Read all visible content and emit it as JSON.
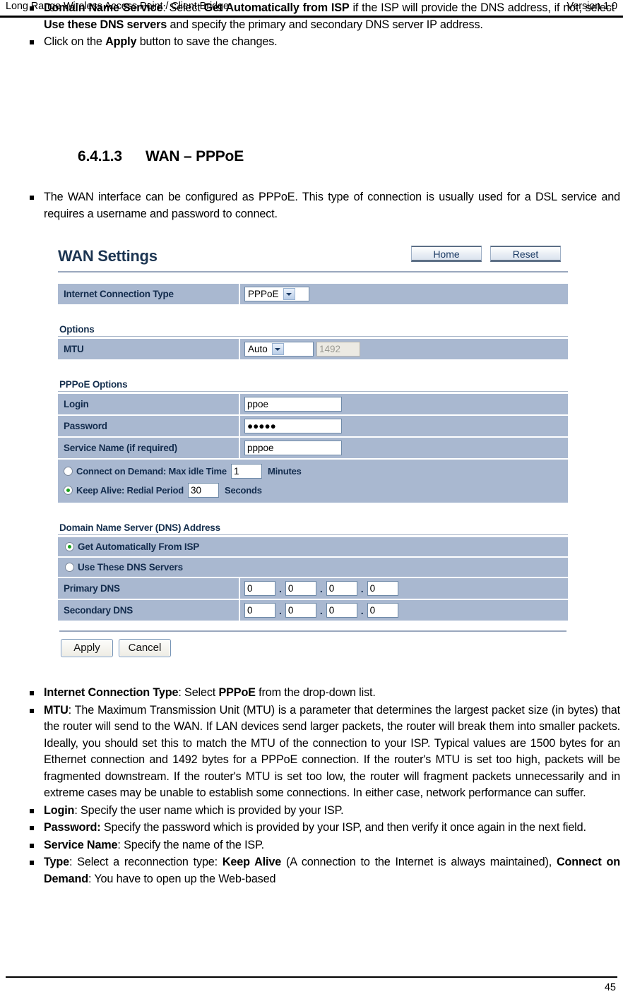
{
  "header": {
    "left": "Long Range Wireless Access Point / Client Bridge",
    "right": "Version 1.0"
  },
  "top_bullets": [
    {
      "parts": [
        {
          "t": "Domain Name Service",
          "b": true
        },
        {
          "t": ": Select ",
          "b": false
        },
        {
          "t": "Get Automatically from ISP",
          "b": true
        },
        {
          "t": " if the ISP will provide the DNS address, if not, select ",
          "b": false
        },
        {
          "t": "Use these DNS servers",
          "b": true
        },
        {
          "t": " and specify the primary and secondary DNS server IP address.",
          "b": false
        }
      ]
    },
    {
      "parts": [
        {
          "t": "Click on the ",
          "b": false
        },
        {
          "t": "Apply",
          "b": true
        },
        {
          "t": " button to save the changes.",
          "b": false
        }
      ]
    }
  ],
  "section": {
    "number": "6.4.1.3",
    "title": "WAN – PPPoE"
  },
  "intro_bullets": [
    {
      "parts": [
        {
          "t": "The WAN interface can be configured as PPPoE. This type of connection is usually used for a DSL service and requires a username and password to connect.",
          "b": false
        }
      ]
    }
  ],
  "screenshot": {
    "title": "WAN Settings",
    "top_buttons": [
      {
        "label": "Home",
        "name": "home-button"
      },
      {
        "label": "Reset",
        "name": "reset-button"
      }
    ],
    "connection": {
      "label": "Internet Connection Type",
      "value": "PPPoE"
    },
    "options_group": {
      "title": "Options",
      "mtu_label": "MTU",
      "mtu_mode": "Auto",
      "mtu_value": "1492"
    },
    "pppoe_group": {
      "title": "PPPoE Options",
      "login_label": "Login",
      "login_value": "ppoe",
      "password_label": "Password",
      "password_value": "●●●●●",
      "service_label": "Service Name (if required)",
      "service_value": "pppoe",
      "connect_on_demand_label": "Connect on Demand: Max idle Time",
      "connect_on_demand_value": "1",
      "connect_on_demand_unit": "Minutes",
      "connect_on_demand_selected": false,
      "keep_alive_label": "Keep Alive: Redial Period",
      "keep_alive_value": "30",
      "keep_alive_unit": "Seconds",
      "keep_alive_selected": true
    },
    "dns_group": {
      "title": "Domain Name Server (DNS) Address",
      "auto_label": "Get Automatically From ISP",
      "auto_selected": true,
      "manual_label": "Use These DNS Servers",
      "manual_selected": false,
      "primary_label": "Primary DNS",
      "primary_octets": [
        "0",
        "0",
        "0",
        "0"
      ],
      "secondary_label": "Secondary DNS",
      "secondary_octets": [
        "0",
        "0",
        "0",
        "0"
      ]
    },
    "actions": [
      {
        "label": "Apply",
        "name": "apply-button"
      },
      {
        "label": "Cancel",
        "name": "cancel-button"
      }
    ]
  },
  "bottom_bullets": [
    {
      "parts": [
        {
          "t": "Internet Connection Type",
          "b": true
        },
        {
          "t": ": Select ",
          "b": false
        },
        {
          "t": "PPPoE",
          "b": true
        },
        {
          "t": " from the drop-down list.",
          "b": false
        }
      ]
    },
    {
      "parts": [
        {
          "t": "MTU",
          "b": true
        },
        {
          "t": ": The Maximum Transmission Unit (MTU) is a parameter that determines the largest packet size (in bytes) that the router will send to the WAN. If LAN devices send larger packets, the router will break them into smaller packets. Ideally, you should set this to match the MTU of the connection to your ISP. Typical values are 1500 bytes for an Ethernet connection and 1492 bytes for a PPPoE connection. If the router's MTU is set too high, packets will be fragmented downstream. If the router's MTU is set too low, the router will fragment packets unnecessarily and in extreme cases may be unable to establish some connections. In either case, network performance can suffer.",
          "b": false
        }
      ]
    },
    {
      "parts": [
        {
          "t": "Login",
          "b": true
        },
        {
          "t": ": Specify the user name which is provided by your ISP.",
          "b": false
        }
      ]
    },
    {
      "parts": [
        {
          "t": "Password:",
          "b": true
        },
        {
          "t": " Specify the password which is provided by your ISP, and then verify it once again in the next field.",
          "b": false
        }
      ]
    },
    {
      "parts": [
        {
          "t": "Service Name",
          "b": true
        },
        {
          "t": ": Specify the name of the ISP.",
          "b": false
        }
      ]
    },
    {
      "parts": [
        {
          "t": "Type",
          "b": true
        },
        {
          "t": ": Select a reconnection type: ",
          "b": false
        },
        {
          "t": "Keep Alive",
          "b": true
        },
        {
          "t": "  (A connection to the Internet is always maintained), ",
          "b": false
        },
        {
          "t": "Connect on Demand",
          "b": true
        },
        {
          "t": ": You have to open up the Web-based",
          "b": false
        }
      ]
    }
  ],
  "footer": {
    "page_number": "45"
  }
}
